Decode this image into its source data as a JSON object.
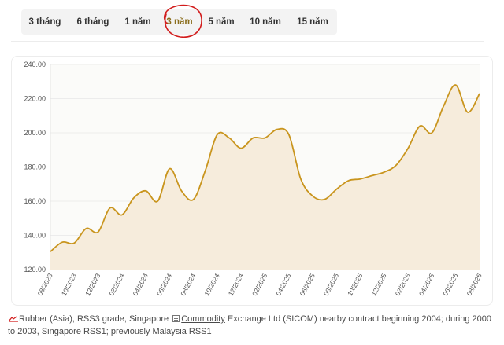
{
  "tabs": [
    {
      "label": "3 tháng"
    },
    {
      "label": "6 tháng"
    },
    {
      "label": "1 năm"
    },
    {
      "label": "3 năm",
      "active": true
    },
    {
      "label": "5 năm"
    },
    {
      "label": "10 năm"
    },
    {
      "label": "15 năm"
    }
  ],
  "footnote": {
    "before": "Rubber (Asia), RSS3 grade, Singapore",
    "link": "Commodity",
    "after": "Exchange Ltd (SICOM) nearby contract beginning 2004; during 2000 to 2003, Singapore RSS1; previously Malaysia RSS1"
  },
  "chart_data": {
    "type": "area",
    "y_ticks": [
      "240.00",
      "220.00",
      "200.00",
      "180.00",
      "160.00",
      "140.00",
      "120.00"
    ],
    "ylim": [
      120,
      240
    ],
    "x_ticks": [
      "08/2023",
      "10/2023",
      "12/2023",
      "02/2024",
      "04/2024",
      "06/2024",
      "08/2024",
      "10/2024",
      "12/2024",
      "02/2025",
      "04/2025",
      "06/2025",
      "08/2025",
      "10/2025",
      "12/2025",
      "02/2026",
      "04/2026",
      "06/2026",
      "08/2026"
    ],
    "grid": true,
    "line_color": "#c9951e",
    "fill_color": "#f6ecdc",
    "series": [
      {
        "points": [
          [
            "08/2023",
            130.5
          ],
          [
            "09/2023",
            136
          ],
          [
            "10/2023",
            135.5
          ],
          [
            "11/2023",
            144
          ],
          [
            "12/2023",
            142
          ],
          [
            "01/2024",
            156
          ],
          [
            "02/2024",
            152
          ],
          [
            "03/2024",
            162
          ],
          [
            "04/2024",
            166
          ],
          [
            "05/2024",
            160
          ],
          [
            "06/2024",
            179
          ],
          [
            "07/2024",
            166
          ],
          [
            "08/2024",
            161
          ],
          [
            "09/2024",
            178
          ],
          [
            "10/2024",
            199
          ],
          [
            "11/2024",
            197
          ],
          [
            "12/2024",
            191
          ],
          [
            "01/2025",
            197
          ],
          [
            "02/2025",
            197
          ],
          [
            "03/2025",
            202
          ],
          [
            "04/2025",
            199
          ],
          [
            "05/2025",
            173
          ],
          [
            "06/2025",
            163
          ],
          [
            "07/2025",
            161
          ],
          [
            "08/2025",
            167
          ],
          [
            "09/2025",
            172
          ],
          [
            "10/2025",
            173
          ],
          [
            "11/2025",
            175
          ],
          [
            "12/2025",
            177
          ],
          [
            "01/2026",
            181
          ],
          [
            "02/2026",
            191
          ],
          [
            "03/2026",
            204
          ],
          [
            "04/2026",
            200
          ],
          [
            "05/2026",
            216
          ],
          [
            "06/2026",
            228
          ],
          [
            "07/2026",
            212
          ],
          [
            "08/2026",
            223
          ]
        ]
      }
    ]
  }
}
